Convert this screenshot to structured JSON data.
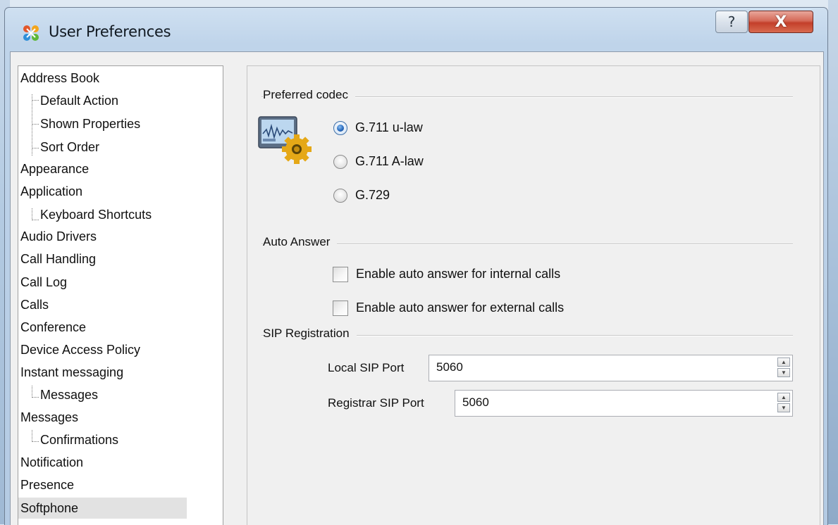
{
  "window": {
    "title": "User Preferences",
    "help_button": "?",
    "close_button": "X"
  },
  "nav_tree": {
    "selected": "Softphone",
    "items": [
      {
        "label": "Address Book",
        "level": 0
      },
      {
        "label": "Default Action",
        "level": 1
      },
      {
        "label": "Shown Properties",
        "level": 1
      },
      {
        "label": "Sort Order",
        "level": 1
      },
      {
        "label": "Appearance",
        "level": 0
      },
      {
        "label": "Application",
        "level": 0
      },
      {
        "label": "Keyboard Shortcuts",
        "level": 1
      },
      {
        "label": "Audio Drivers",
        "level": 0
      },
      {
        "label": "Call Handling",
        "level": 0
      },
      {
        "label": "Call Log",
        "level": 0
      },
      {
        "label": "Calls",
        "level": 0
      },
      {
        "label": "Conference",
        "level": 0
      },
      {
        "label": "Device Access Policy",
        "level": 0
      },
      {
        "label": "Instant messaging",
        "level": 0
      },
      {
        "label": "Messages",
        "level": 1
      },
      {
        "label": "Messages",
        "level": 0
      },
      {
        "label": "Confirmations",
        "level": 1
      },
      {
        "label": "Notification",
        "level": 0
      },
      {
        "label": "Presence",
        "level": 0
      },
      {
        "label": "Softphone",
        "level": 0
      }
    ]
  },
  "codec": {
    "group_label": "Preferred codec",
    "icon": "codec-settings-icon",
    "options": [
      "G.711 u-law",
      "G.711 A-law",
      "G.729"
    ],
    "selected": "G.711 u-law"
  },
  "auto_answer": {
    "group_label": "Auto Answer",
    "internal_label": "Enable auto answer for internal calls",
    "internal_checked": false,
    "external_label": "Enable auto answer for external calls",
    "external_checked": false
  },
  "sip": {
    "group_label": "SIP Registration",
    "local_port_label": "Local SIP Port",
    "local_port_value": "5060",
    "registrar_port_label": "Registrar SIP Port",
    "registrar_port_value": "5060"
  },
  "colors": {
    "selection_background": "#e2e2e2",
    "radio_accent": "#2a6cc0",
    "close_button": "#c33f2a"
  }
}
